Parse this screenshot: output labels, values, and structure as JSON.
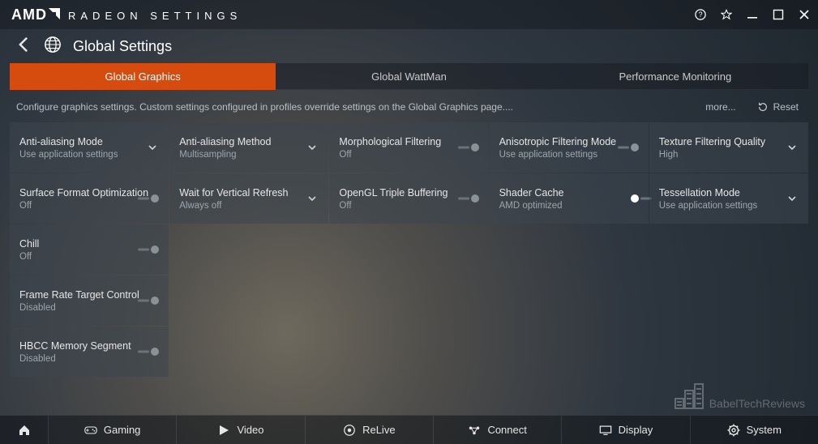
{
  "app": {
    "brand": "AMD",
    "title": "RADEON SETTINGS"
  },
  "page": {
    "title": "Global Settings",
    "tabs": [
      {
        "label": "Global Graphics",
        "active": true
      },
      {
        "label": "Global WattMan",
        "active": false
      },
      {
        "label": "Performance Monitoring",
        "active": false
      }
    ],
    "description": "Configure graphics settings. Custom settings configured in profiles override settings on the Global Graphics page....",
    "more": "more...",
    "reset": "Reset"
  },
  "settings": [
    {
      "label": "Anti-aliasing Mode",
      "value": "Use application settings",
      "control": "dropdown"
    },
    {
      "label": "Anti-aliasing Method",
      "value": "Multisampling",
      "control": "dropdown"
    },
    {
      "label": "Morphological Filtering",
      "value": "Off",
      "control": "toggle",
      "on": false
    },
    {
      "label": "Anisotropic Filtering Mode",
      "value": "Use application settings",
      "control": "toggle",
      "on": false
    },
    {
      "label": "Texture Filtering Quality",
      "value": "High",
      "control": "dropdown"
    },
    {
      "label": "Surface Format Optimization",
      "value": "Off",
      "control": "toggle",
      "on": false
    },
    {
      "label": "Wait for Vertical Refresh",
      "value": "Always off",
      "control": "dropdown"
    },
    {
      "label": "OpenGL Triple Buffering",
      "value": "Off",
      "control": "toggle",
      "on": false
    },
    {
      "label": "Shader Cache",
      "value": "AMD optimized",
      "control": "toggle",
      "on": true
    },
    {
      "label": "Tessellation Mode",
      "value": "Use application settings",
      "control": "dropdown"
    },
    {
      "label": "Chill",
      "value": "Off",
      "control": "toggle",
      "on": false
    },
    {
      "label": "Frame Rate Target Control",
      "value": "Disabled",
      "control": "toggle",
      "on": false
    },
    {
      "label": "HBCC Memory Segment",
      "value": "Disabled",
      "control": "toggle",
      "on": false
    }
  ],
  "nav": {
    "home": "Home",
    "items": [
      {
        "label": "Gaming",
        "icon": "gamepad-icon"
      },
      {
        "label": "Video",
        "icon": "play-icon"
      },
      {
        "label": "ReLive",
        "icon": "relive-icon"
      },
      {
        "label": "Connect",
        "icon": "connect-icon"
      },
      {
        "label": "Display",
        "icon": "monitor-icon"
      },
      {
        "label": "System",
        "icon": "gear-icon"
      }
    ]
  },
  "watermark": "BabelTechReviews"
}
